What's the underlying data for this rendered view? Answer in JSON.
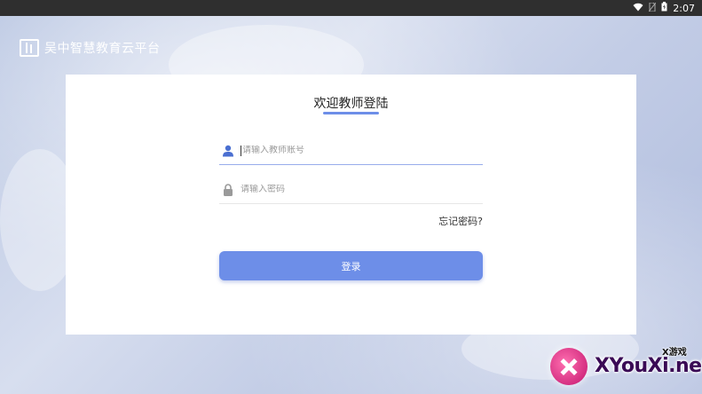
{
  "status_bar": {
    "time": "2:07"
  },
  "header": {
    "title": "吴中智慧教育云平台",
    "logo_icon": "book-logo-icon"
  },
  "login": {
    "title": "欢迎教师登陆",
    "account_placeholder": "请输入教师账号",
    "password_placeholder": "请输入密码",
    "forgot_password": "忘记密码?",
    "submit_label": "登录",
    "accent_color": "#6d8ee8"
  },
  "watermark": {
    "top_text": "X游戏",
    "main_text": "XYouXi.net"
  }
}
